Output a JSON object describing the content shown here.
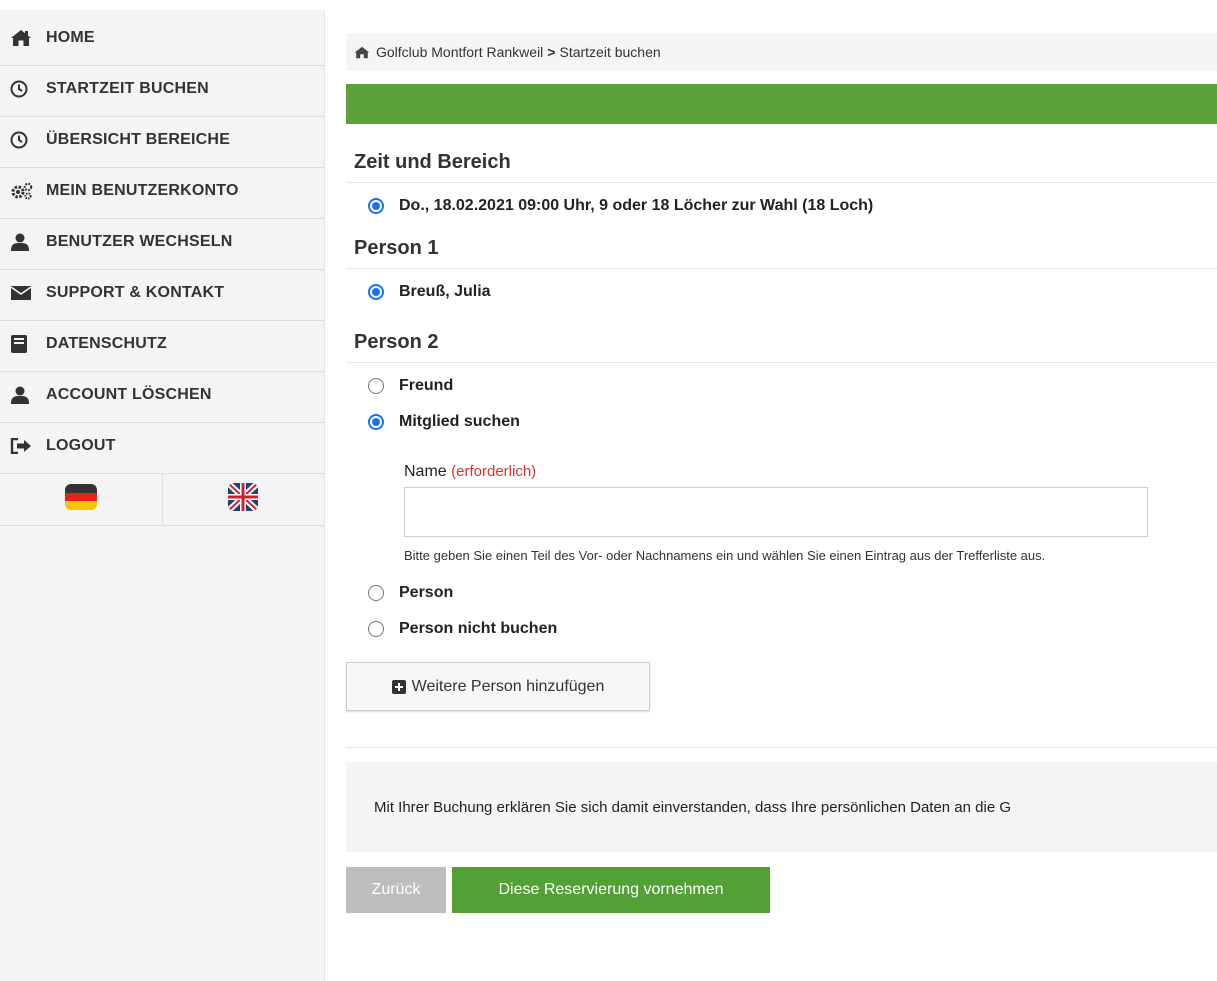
{
  "sidebar": {
    "items": [
      {
        "label": "HOME",
        "icon": "home-icon"
      },
      {
        "label": "STARTZEIT BUCHEN",
        "icon": "clock-icon"
      },
      {
        "label": "ÜBERSICHT BEREICHE",
        "icon": "clock-icon"
      },
      {
        "label": "MEIN BENUTZERKONTO",
        "icon": "gears-icon"
      },
      {
        "label": "BENUTZER WECHSELN",
        "icon": "user-icon"
      },
      {
        "label": "SUPPORT & KONTAKT",
        "icon": "envelope-icon"
      },
      {
        "label": "DATENSCHUTZ",
        "icon": "book-icon"
      },
      {
        "label": "ACCOUNT LÖSCHEN",
        "icon": "user-icon"
      },
      {
        "label": "LOGOUT",
        "icon": "sign-out-icon"
      }
    ],
    "languages": [
      {
        "code": "de",
        "icon": "german-flag-icon"
      },
      {
        "code": "en",
        "icon": "uk-flag-icon"
      }
    ]
  },
  "breadcrumb": {
    "club": "Golfclub Montfort Rankweil",
    "separator": ">",
    "page": "Startzeit buchen"
  },
  "colors": {
    "progress": "#5aa33a",
    "submit": "#53a134",
    "back": "#bdbdbd",
    "required": "#d9342b",
    "radio": "#1a73e8"
  },
  "sections": {
    "time": {
      "title": "Zeit und Bereich",
      "option": "Do., 18.02.2021 09:00 Uhr, 9 oder 18 Löcher zur Wahl (18 Loch)"
    },
    "person1": {
      "title": "Person 1",
      "option": "Breuß, Julia"
    },
    "person2": {
      "title": "Person 2",
      "options": {
        "friend": "Freund",
        "member": "Mitglied suchen",
        "person": "Person",
        "none": "Person nicht buchen"
      },
      "name_label": "Name",
      "name_required": "(erforderlich)",
      "name_value": "",
      "help": "Bitte geben Sie einen Teil des Vor- oder Nachnamens ein und wählen Sie einen Eintrag aus der Trefferliste aus."
    }
  },
  "add_person_label": "Weitere Person hinzufügen",
  "consent_text": "Mit Ihrer Buchung erklären Sie sich damit einverstanden, dass Ihre persönlichen Daten an die G",
  "buttons": {
    "back": "Zurück",
    "submit": "Diese Reservierung vornehmen"
  }
}
